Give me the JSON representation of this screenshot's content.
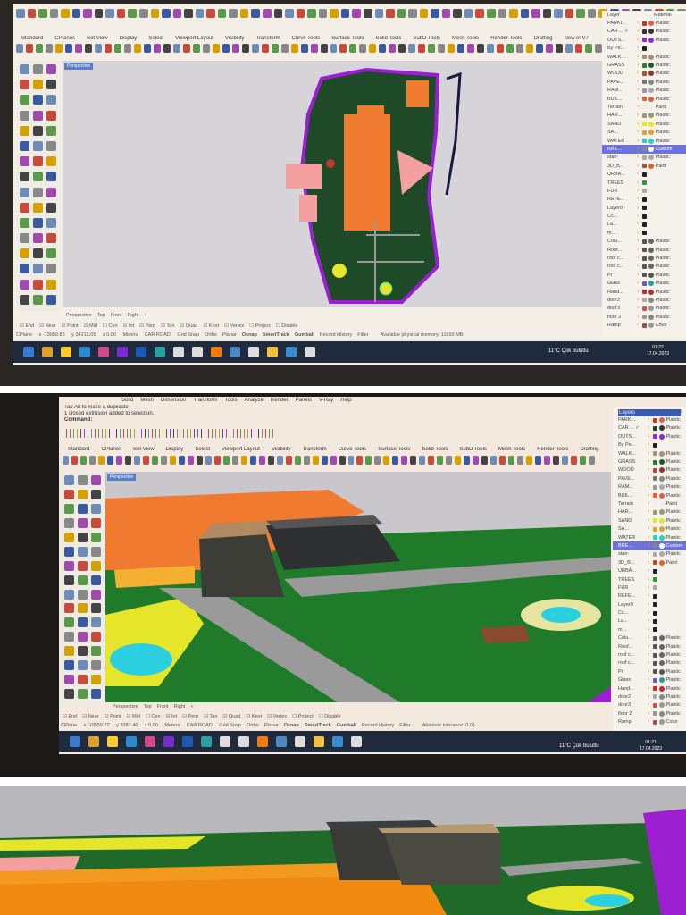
{
  "toolbar_tabs": [
    "Standard",
    "CPlanes",
    "Set View",
    "Display",
    "Select",
    "Viewport Layout",
    "Visibility",
    "Transform",
    "Curve Tools",
    "Surface Tools",
    "Solid Tools",
    "SubD Tools",
    "Mesh Tools",
    "Render Tools",
    "Drafting",
    "New in V7"
  ],
  "viewport_label": "Perspective",
  "viewport_tabs": [
    "Perspective",
    "Top",
    "Front",
    "Right",
    "+"
  ],
  "osnaps": [
    "End",
    "Near",
    "Point",
    "Mid",
    "Cen",
    "Int",
    "Perp",
    "Tan",
    "Quad",
    "Knot",
    "Vertex",
    "Project",
    "Disable"
  ],
  "status": {
    "cplane": "CPlane",
    "units": "Meters",
    "layer": "CAR ROAD",
    "toggles": [
      "Grid Snap",
      "Ortho",
      "Planar",
      "Osnap",
      "SmartTrack",
      "Gumball",
      "Record History",
      "Filter"
    ]
  },
  "screen1": {
    "coords": [
      "x -19959.83",
      "y 34215.05",
      "z 0.00"
    ],
    "message": "Available physical memory: 11693 MB",
    "time": "01:22",
    "date": "17.04.2023"
  },
  "screen2": {
    "menu": [
      "Solid",
      "Mesh",
      "Dimension",
      "Transform",
      "Tools",
      "Analyze",
      "Render",
      "Panels",
      "V-Ray",
      "Help"
    ],
    "command_history": [
      "Tap Alt to make a duplicate",
      "1 closed extrusion added to selection."
    ],
    "command_label": "Command:",
    "coords": [
      "x -19559.72",
      "y 3387.46",
      "z 0.00"
    ],
    "message": "Absolute tolerance: 0.01",
    "time": "01:21",
    "date": "17.04.2023",
    "panel_title": "Layers"
  },
  "weather": "11°C  Çok bulutlu",
  "layers_header": [
    "Layer",
    "Material"
  ],
  "layers": [
    {
      "name": "PARKI...",
      "color": "#c0392b",
      "mat": "#e0604a",
      "m": "Plastic"
    },
    {
      "name": "CAR ... ✓",
      "color": "#333",
      "mat": "#333",
      "m": "Plastic"
    },
    {
      "name": "OUTS...",
      "color": "#8e2bd0",
      "mat": "#8e2bd0",
      "m": "Plastic"
    },
    {
      "name": "By Pe...",
      "color": "#222",
      "mat": "",
      "m": ""
    },
    {
      "name": "WALK...",
      "color": "#a89070",
      "mat": "#a89070",
      "m": "Plastic"
    },
    {
      "name": "GRASS",
      "color": "#2a7a35",
      "mat": "#1f5a2a",
      "m": "Plastic"
    },
    {
      "name": "WOOD",
      "color": "#b24a3a",
      "mat": "#8a3a2a",
      "m": "Plastic"
    },
    {
      "name": "PAVE...",
      "color": "#777",
      "mat": "#888",
      "m": "Plastic"
    },
    {
      "name": "RAM...",
      "color": "#999",
      "mat": "#aaa",
      "m": "Plastic"
    },
    {
      "name": "BUIL...",
      "color": "#e0603a",
      "mat": "#e0603a",
      "m": "Plastic"
    },
    {
      "name": "Terrain",
      "color": "#eee",
      "mat": "#eee",
      "m": "Paint"
    },
    {
      "name": "HAR...",
      "color": "#9a9a70",
      "mat": "#9a9a70",
      "m": "Plastic"
    },
    {
      "name": "SAND",
      "color": "#e5e52a",
      "mat": "#e5e52a",
      "m": "Plastic"
    },
    {
      "name": "SA...",
      "color": "#e0a030",
      "mat": "#e0a030",
      "m": "Plastic"
    },
    {
      "name": "WATER",
      "color": "#2ad0c8",
      "mat": "#2ad0c8",
      "m": "Plastic"
    },
    {
      "name": "BRE...",
      "color": "#888",
      "mat": "#fff",
      "m": "Custom"
    },
    {
      "name": "stair-",
      "color": "#aaa",
      "mat": "#aaa",
      "m": "Plastic"
    },
    {
      "name": "3D_B...",
      "color": "#b05030",
      "mat": "#e06030",
      "m": "Paint"
    },
    {
      "name": "URBA...",
      "color": "#222",
      "mat": "",
      "m": ""
    },
    {
      "name": "TREES",
      "color": "#2a9a3a",
      "mat": "",
      "m": ""
    },
    {
      "name": "FUR",
      "color": "#aaa",
      "mat": "",
      "m": ""
    },
    {
      "name": "REFE...",
      "color": "#222",
      "mat": "",
      "m": ""
    },
    {
      "name": "Layer0",
      "color": "#222",
      "mat": "",
      "m": ""
    },
    {
      "name": "Cc...",
      "color": "#222",
      "mat": "",
      "m": ""
    },
    {
      "name": "La...",
      "color": "#222",
      "mat": "",
      "m": ""
    },
    {
      "name": "m...",
      "color": "#222",
      "mat": "",
      "m": ""
    },
    {
      "name": "Colu...",
      "color": "#555",
      "mat": "#666",
      "m": "Plastic"
    },
    {
      "name": "Roof...",
      "color": "#555",
      "mat": "#666",
      "m": "Plastic"
    },
    {
      "name": "roof c...",
      "color": "#555",
      "mat": "#666",
      "m": "Plastic"
    },
    {
      "name": "roof c...",
      "color": "#555",
      "mat": "#666",
      "m": "Plastic"
    },
    {
      "name": "Pr",
      "color": "#555",
      "mat": "#555",
      "m": "Plastic"
    },
    {
      "name": "Glass",
      "color": "#6060c0",
      "mat": "#2a9a9a",
      "m": "Plastic"
    },
    {
      "name": "Hand...",
      "color": "#c02a2a",
      "mat": "#c02a2a",
      "m": "Plastic"
    },
    {
      "name": "door2",
      "color": "#aaa",
      "mat": "#888",
      "m": "Plastic"
    },
    {
      "name": "door3",
      "color": "#d05050",
      "mat": "#999",
      "m": "Plastic"
    },
    {
      "name": "floor 2",
      "color": "#999",
      "mat": "#888",
      "m": "Plastic"
    },
    {
      "name": "Ramp",
      "color": "#a05050",
      "mat": "#999",
      "m": "Color"
    }
  ],
  "selected_layer_index": 15,
  "colors": {
    "accent": "#5a7fc7",
    "taskbar": "#1f2a3c",
    "grass": "#1f5a2a",
    "building": "#f07a30",
    "boundary": "#9b1fd0"
  }
}
